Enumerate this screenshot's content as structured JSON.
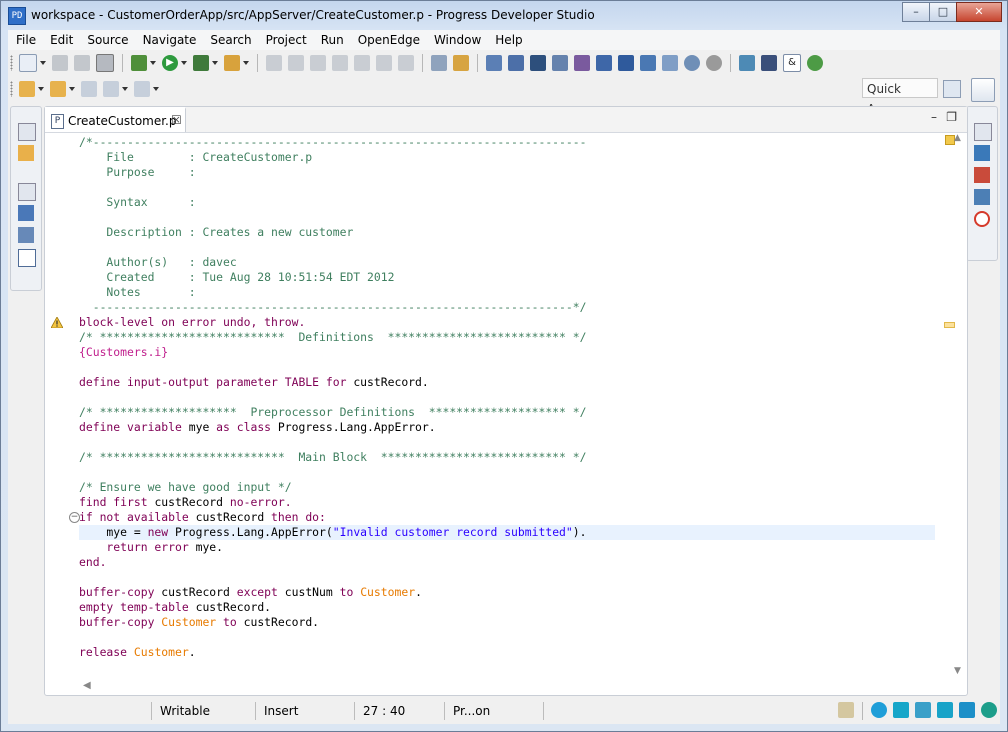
{
  "window": {
    "title": "workspace - CustomerOrderApp/src/AppServer/CreateCustomer.p - Progress Developer Studio",
    "app_icon": "progress-app-icon",
    "minimize_label": "–",
    "maximize_label": "□",
    "close_label": "✕"
  },
  "menu": [
    "File",
    "Edit",
    "Source",
    "Navigate",
    "Search",
    "Project",
    "Run",
    "OpenEdge",
    "Window",
    "Help"
  ],
  "quick_access": "Quick Access",
  "editor": {
    "tab_label": "CreateCustomer.p",
    "tab_icon_letter": "P",
    "tab_close": "☒",
    "minimize": "–",
    "maximize": "❐"
  },
  "code_lines": [
    [
      [
        "cm",
        "/*------------------------------------------------------------------------"
      ]
    ],
    [
      [
        "cm",
        "    File        : CreateCustomer.p"
      ]
    ],
    [
      [
        "cm",
        "    Purpose     :"
      ]
    ],
    [
      [
        "cm",
        ""
      ]
    ],
    [
      [
        "cm",
        "    Syntax      :"
      ]
    ],
    [
      [
        "cm",
        ""
      ]
    ],
    [
      [
        "cm",
        "    Description : Creates a new customer"
      ]
    ],
    [
      [
        "cm",
        ""
      ]
    ],
    [
      [
        "cm",
        "    Author(s)   : davec"
      ]
    ],
    [
      [
        "cm",
        "    Created     : Tue Aug 28 10:51:54 EDT 2012"
      ]
    ],
    [
      [
        "cm",
        "    Notes       :"
      ]
    ],
    [
      [
        "cm",
        "  ----------------------------------------------------------------------*/"
      ]
    ],
    [
      [
        "kw",
        "block-level on error undo, throw."
      ]
    ],
    [
      [
        "cm",
        "/* ***************************  Definitions  ************************** */"
      ]
    ],
    [
      [
        "inc",
        "{Customers.i}"
      ]
    ],
    [
      [
        "id",
        ""
      ]
    ],
    [
      [
        "kw",
        "define input-output parameter TABLE for "
      ],
      [
        "id",
        "custRecord."
      ]
    ],
    [
      [
        "id",
        ""
      ]
    ],
    [
      [
        "cm",
        "/* ********************  Preprocessor Definitions  ******************** */"
      ]
    ],
    [
      [
        "kw",
        "define variable "
      ],
      [
        "id",
        "mye "
      ],
      [
        "kw",
        "as class "
      ],
      [
        "id",
        "Progress.Lang.AppError."
      ]
    ],
    [
      [
        "id",
        ""
      ]
    ],
    [
      [
        "cm",
        "/* ***************************  Main Block  *************************** */"
      ]
    ],
    [
      [
        "id",
        ""
      ]
    ],
    [
      [
        "cm",
        "/* Ensure we have good input */"
      ]
    ],
    [
      [
        "kw",
        "find first "
      ],
      [
        "id",
        "custRecord "
      ],
      [
        "kw",
        "no-error."
      ]
    ],
    [
      [
        "kw",
        "if not available "
      ],
      [
        "id",
        "custRecord "
      ],
      [
        "kw",
        "then do:"
      ]
    ],
    [
      [
        "id",
        "    mye = "
      ],
      [
        "kw",
        "new "
      ],
      [
        "id",
        "Progress.Lang.AppError("
      ],
      [
        "str",
        "\"Invalid customer record submitted\""
      ],
      [
        "id",
        ")."
      ]
    ],
    [
      [
        "kw",
        "    return error "
      ],
      [
        "id",
        "mye."
      ]
    ],
    [
      [
        "kw",
        "end."
      ]
    ],
    [
      [
        "id",
        ""
      ]
    ],
    [
      [
        "kw",
        "buffer-copy "
      ],
      [
        "id",
        "custRecord "
      ],
      [
        "kw",
        "except "
      ],
      [
        "id",
        "custNum "
      ],
      [
        "kw",
        "to "
      ],
      [
        "tbl",
        "Customer"
      ],
      [
        "id",
        "."
      ]
    ],
    [
      [
        "kw",
        "empty temp-table "
      ],
      [
        "id",
        "custRecord."
      ]
    ],
    [
      [
        "kw",
        "buffer-copy "
      ],
      [
        "tbl",
        "Customer "
      ],
      [
        "kw",
        "to "
      ],
      [
        "id",
        "custRecord."
      ]
    ],
    [
      [
        "id",
        ""
      ]
    ],
    [
      [
        "kw",
        "release "
      ],
      [
        "tbl",
        "Customer"
      ],
      [
        "id",
        "."
      ]
    ]
  ],
  "current_line_index": 26,
  "warning_line_index": 12,
  "fold_line_index": 25,
  "status": {
    "writable": "Writable",
    "insert": "Insert",
    "position": "27 : 40",
    "progress": "Pr...on"
  },
  "colors": {
    "keyword": "#7f0055",
    "comment": "#3f7f5f",
    "string": "#2a00ff",
    "include": "#c0208d",
    "table": "#e77a00",
    "current_line": "#e8f2fe"
  }
}
